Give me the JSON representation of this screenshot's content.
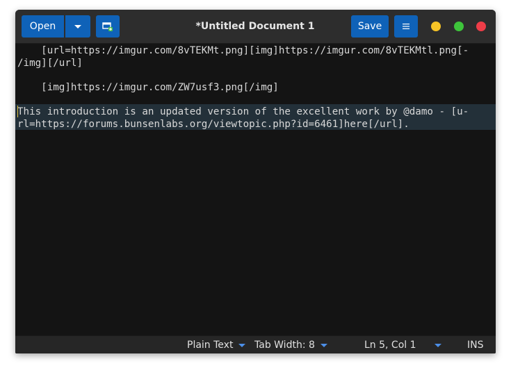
{
  "window": {
    "title": "*Untitled Document 1"
  },
  "toolbar": {
    "open_label": "Open",
    "open_dropdown_icon": "chevron-down-icon",
    "new_document_icon": "new-document-icon",
    "save_label": "Save",
    "menu_icon": "hamburger-menu-icon"
  },
  "window_controls": {
    "minimize_color": "#f6c326",
    "maximize_color": "#3ec43b",
    "close_color": "#ee3d48"
  },
  "editor": {
    "lines": [
      "    [url=https://imgur.com/8vTEKMt.png][img]https://imgur.com/8vTEKMtl.png[-",
      "/img][/url]",
      "",
      "    [img]https://imgur.com/ZW7usf3.png[/img]",
      "",
      "This introduction is an updated version of the excellent work by @damo - [u-",
      "rl=https://forums.bunsenlabs.org/viewtopic.php?id=6461]here[/url]."
    ],
    "current_line_highlight": "#233039"
  },
  "statusbar": {
    "language": "Plain Text",
    "tab_width": "Tab Width: 8",
    "position": "Ln 5, Col 1",
    "mode": "INS"
  },
  "colors": {
    "accent": "#0f62b8",
    "editor_bg": "#141414",
    "headerbar_bg": "#2d2d2d"
  }
}
